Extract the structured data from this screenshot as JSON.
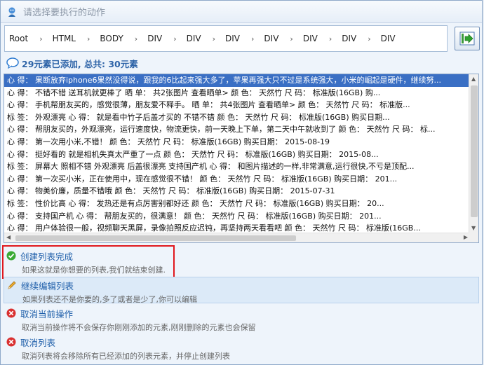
{
  "title": "请选择要执行的动作",
  "breadcrumb": [
    "Root",
    "HTML",
    "BODY",
    "DIV",
    "DIV",
    "DIV",
    "DIV",
    "DIV",
    "DIV",
    "DIV"
  ],
  "count_text": "29元素已添加, 总共: 30元素",
  "list_rows": [
    "心 得：  果断放弃iphone6果然没得说，跟我的6比起来强大多了，苹果再强大只不过是系统强大，小米的崛起是硬件，继续努...",
    "心 得：  不错不错 送耳机就更棒了 晒 单：  共2张图片 查看晒单>  颜 色：  天然竹  尺 码：  标准版(16GB)  购...",
    "心 得：  手机帮朋友买的，感觉很薄，朋友爱不释手。 晒 单：  共4张图片 查看晒单>  颜 色：  天然竹  尺 码：  标准版...",
    "标 签：  外观漂亮  心 得：  就是看中竹子后盖才买的 不错不错  颜 色：  天然竹  尺 码：  标准版(16GB)  购买日期...",
    "心 得：  帮朋友买的，外观漂亮，运行速度快，物流更快，前一天晚上下单，第二天中午就收到了  颜 色：  天然竹  尺 码：  标...",
    "心 得：  第一次用小米,不错！  颜 色：  天然竹  尺 码：  标准版(16GB)  购买日期：  2015-08-19",
    "心 得：  挺好看的 就是相机失真太严重了一点  颜 色：  天然竹  尺 码：  标准版(16GB)  购买日期：  2015-08...",
    "标 签：  屏幕大  照相不错  外观漂亮  后盖很漂亮  支持国产机  心 得：  和图片描述的一样,非常满意,运行很快,不亏是顶配...",
    "心 得：  第一次买小米，正在使用中，现在感觉很不错！  颜 色：  天然竹  尺 码：  标准版(16GB)  购买日期：  201...",
    "心 得：  物美价廉，质量不错哦  颜 色：  天然竹  尺 码：  标准版(16GB)  购买日期：  2015-07-31",
    "标 签：  性价比高  心 得：  发热还是有点厉害别都好还  颜 色：  天然竹  尺 码：  标准版(16GB)  购买日期：  20...",
    "心 得：  支持国产机  心 得：  帮朋友买的，很满意！  颜 色：  天然竹  尺 码：  标准版(16GB)  购买日期：  201...",
    "心 得：  用户体验很一般，视频聊天黑屏，录像拍照反应迟钝，再坚持两天看看吧  颜 色：  天然竹  尺 码：  标准版(16GB..."
  ],
  "actions": [
    {
      "label": "创建列表完成",
      "desc": "如果这就是你想要的列表,我们就结束创建.",
      "icon": "check-circle-icon",
      "color": "#2fa12f"
    },
    {
      "label": "继续编辑列表",
      "desc": "如果列表还不是你要的,多了或者是少了,你可以编辑",
      "icon": "pencil-icon",
      "color": "#e0a020"
    },
    {
      "label": "取消当前操作",
      "desc": "取消当前操作将不会保存你刚刚添加的元素,刚刚删除的元素也会保留",
      "icon": "cancel-circle-icon",
      "color": "#d42a2a"
    },
    {
      "label": "取消列表",
      "desc": "取消列表将会移除所有已经添加的列表元素，并停止创建列表",
      "icon": "cancel-circle-icon",
      "color": "#d42a2a"
    }
  ],
  "colors": {
    "selected_row": "#3a6fc4",
    "link": "#1f5faa",
    "highlight_box": "#e0171d"
  }
}
